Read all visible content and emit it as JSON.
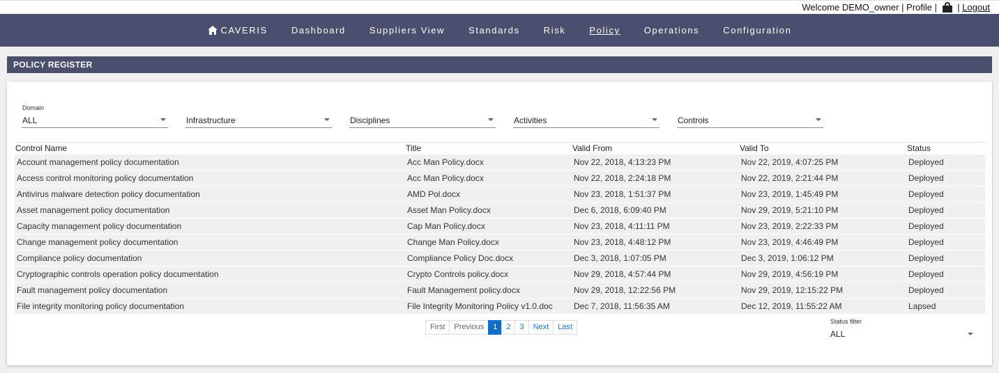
{
  "topbar": {
    "welcome": "Welcome DEMO_owner",
    "sep1": " | ",
    "profile": "Profile",
    "sep2": " | ",
    "sep3": " | ",
    "logout": "Logout"
  },
  "nav": {
    "brand": "CAVERIS",
    "items": [
      "Dashboard",
      "Suppliers View",
      "Standards",
      "Risk",
      "Policy",
      "Operations",
      "Configuration"
    ],
    "active": "Policy"
  },
  "section": {
    "title": "POLICY REGISTER"
  },
  "filters": {
    "domain_label": "Domain",
    "domain_value": "ALL",
    "infrastructure": "Infrastructure",
    "disciplines": "Disciplines",
    "activities": "Activities",
    "controls": "Controls"
  },
  "table": {
    "headers": [
      "Control Name",
      "Title",
      "Valid From",
      "Valid To",
      "Status"
    ],
    "rows": [
      [
        "Account management policy documentation",
        "Acc Man Policy.docx",
        "Nov 22, 2018, 4:13:23 PM",
        "Nov 22, 2019, 4:07:25 PM",
        "Deployed"
      ],
      [
        "Access control monitoring policy documentation",
        "Acc Man Policy.docx",
        "Nov 22, 2018, 2:24:18 PM",
        "Nov 22, 2019, 2:21:44 PM",
        "Deployed"
      ],
      [
        "Antivirus malware detection policy documentation",
        "AMD Pol.docx",
        "Nov 23, 2018, 1:51:37 PM",
        "Nov 23, 2019, 1:45:49 PM",
        "Deployed"
      ],
      [
        "Asset management policy documentation",
        "Asset Man Policy.docx",
        "Dec 6, 2018, 6:09:40 PM",
        "Nov 29, 2019, 5:21:10 PM",
        "Deployed"
      ],
      [
        "Capacity management policy documentation",
        "Cap Man Policy.docx",
        "Nov 23, 2018, 4:11:11 PM",
        "Nov 23, 2019, 2:22:33 PM",
        "Deployed"
      ],
      [
        "Change management policy documentation",
        "Change Man Policy.docx",
        "Nov 23, 2018, 4:48:12 PM",
        "Nov 23, 2019, 4:46:49 PM",
        "Deployed"
      ],
      [
        "Compliance policy documentation",
        "Compliance Policy Doc.docx",
        "Dec 3, 2018, 1:07:05 PM",
        "Dec 3, 2019, 1:06:12 PM",
        "Deployed"
      ],
      [
        "Cryptographic controls operation policy documentation",
        "Crypto Controls policy.docx",
        "Nov 29, 2018, 4:57:44 PM",
        "Nov 29, 2019, 4:56:19 PM",
        "Deployed"
      ],
      [
        "Fault management policy documentation",
        "Fault Management policy.docx",
        "Nov 29, 2018, 12:22:56 PM",
        "Nov 29, 2019, 12:15:22 PM",
        "Deployed"
      ],
      [
        "File integrity monitoring policy documentation",
        "File Integrity Monitoring Policy v1.0.doc",
        "Dec 7, 2018, 11:56:35 AM",
        "Dec 12, 2019, 11:55:22 AM",
        "Lapsed"
      ]
    ]
  },
  "pager": {
    "first": "First",
    "previous": "Previous",
    "pages": [
      "1",
      "2",
      "3"
    ],
    "current": "1",
    "next": "Next",
    "last": "Last"
  },
  "status_filter": {
    "label": "Status filter",
    "value": "ALL"
  },
  "colors": {
    "nav_bg": "#4a4f6e",
    "pager_active": "#0d6ecb"
  }
}
